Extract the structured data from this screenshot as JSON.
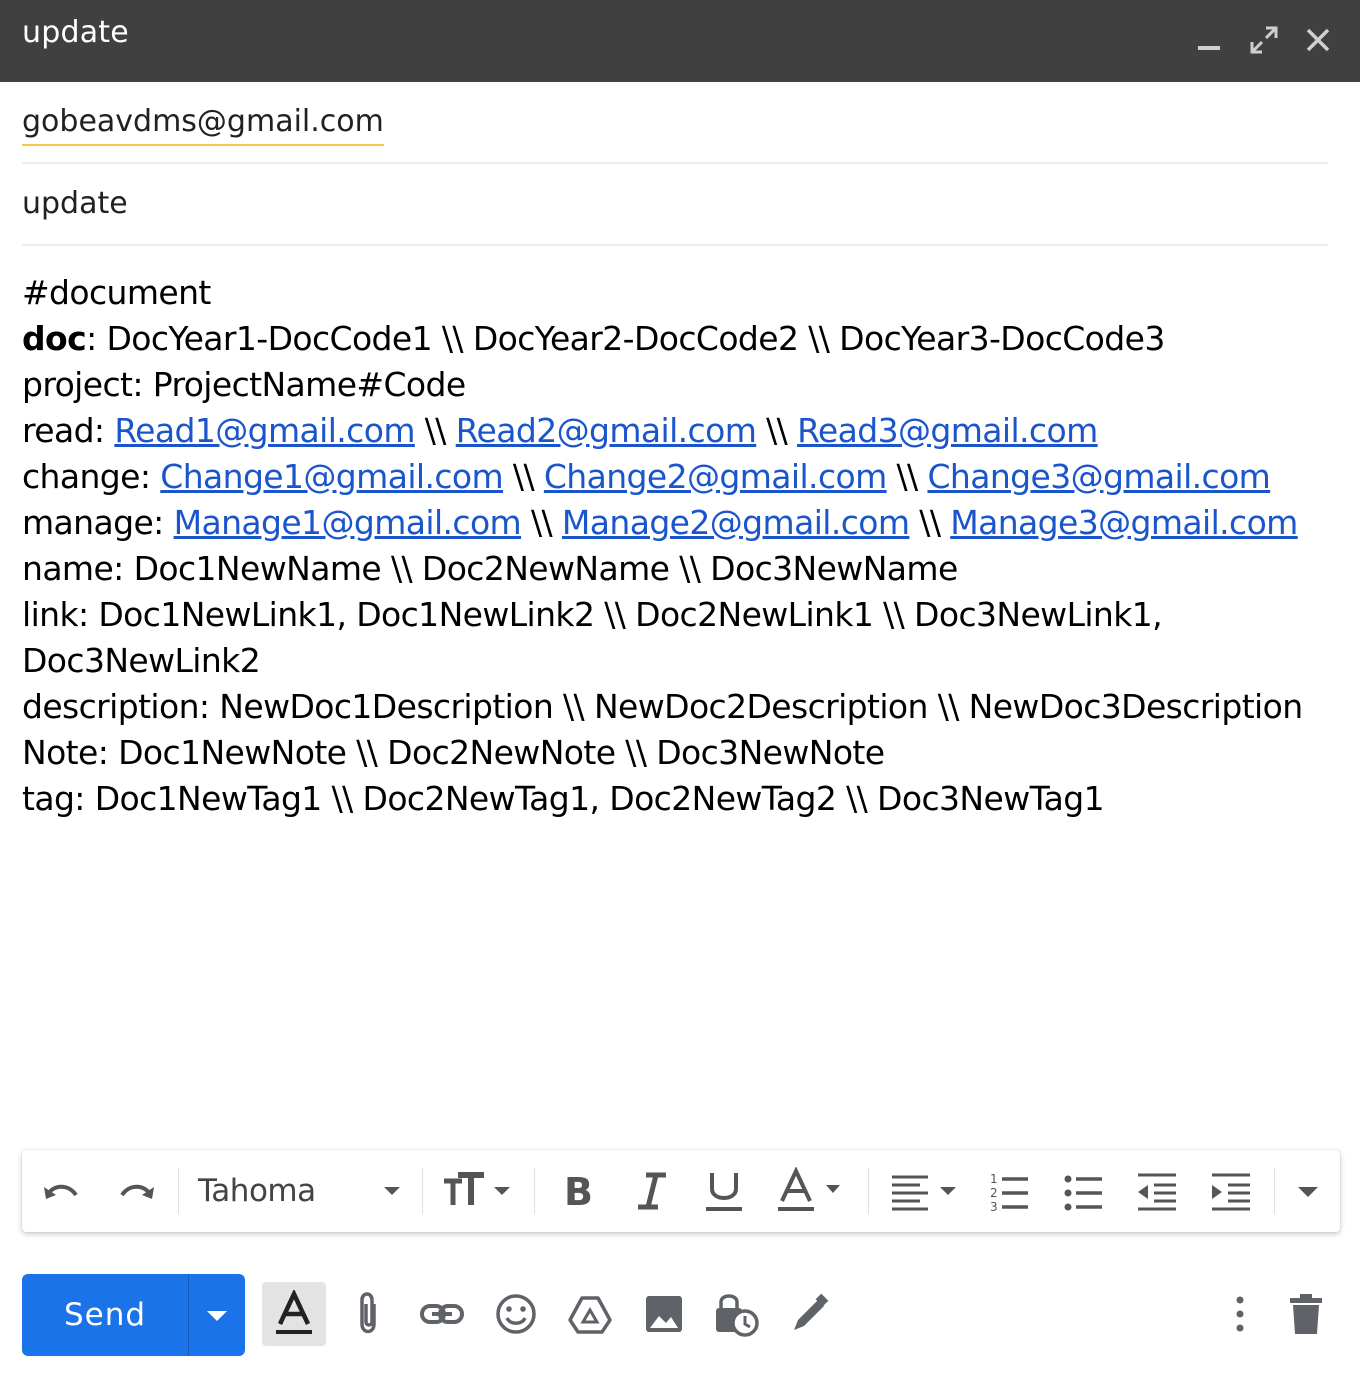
{
  "window": {
    "title": "update"
  },
  "to": {
    "recipient": "gobeavdms@gmail.com"
  },
  "subject": {
    "value": "update"
  },
  "body": {
    "l1": "#document",
    "l2_label": "doc",
    "l2_value": ": DocYear1-DocCode1 \\\\ DocYear2-DocCode2 \\\\ DocYear3-DocCode3",
    "l3": "project: ProjectName#Code",
    "l4_label": "read: ",
    "l4_link1": "Read1@gmail.com",
    "l4_link2": "Read2@gmail.com",
    "l4_link3": "Read3@gmail.com",
    "l5_label": "change: ",
    "l5_link1": "Change1@gmail.com",
    "l5_link2": "Change2@gmail.com",
    "l5_link3": "Change3@gmail.com",
    "l6_label": "manage: ",
    "l6_link1": "Manage1@gmail.com",
    "l6_link2": "Manage2@gmail.com",
    "l6_link3": "Manage3@gmail.com",
    "sep": " \\\\ ",
    "l7": "name: Doc1NewName \\\\ Doc2NewName \\\\ Doc3NewName",
    "l8": "link: Doc1NewLink1, Doc1NewLink2 \\\\ Doc2NewLink1 \\\\ Doc3NewLink1,",
    "l9": "Doc3NewLink2",
    "l10": "description: NewDoc1Description \\\\ NewDoc2Description \\\\ NewDoc3Description",
    "l11": "Note: Doc1NewNote \\\\ Doc2NewNote \\\\ Doc3NewNote",
    "l12": "tag: Doc1NewTag1 \\\\ Doc2NewTag1, Doc2NewTag2 \\\\ Doc3NewTag1"
  },
  "formatting_toolbar": {
    "font": "Tahoma",
    "icons": [
      "undo-icon",
      "redo-icon",
      "font-size-icon",
      "bold-icon",
      "italic-icon",
      "underline-icon",
      "text-color-icon",
      "align-icon",
      "numbered-list-icon",
      "bulleted-list-icon",
      "indent-less-icon",
      "indent-more-icon",
      "more-formatting-icon"
    ]
  },
  "actions": {
    "send_label": "Send",
    "icons": [
      "formatting-options-icon",
      "attach-icon",
      "link-icon",
      "emoji-icon",
      "drive-icon",
      "photo-icon",
      "confidential-icon",
      "signature-icon",
      "more-options-icon",
      "discard-icon"
    ]
  },
  "colors": {
    "titlebar": "#404040",
    "send": "#1a73e8",
    "link": "#1a55cc",
    "chip_underline": "#f2c94c"
  }
}
